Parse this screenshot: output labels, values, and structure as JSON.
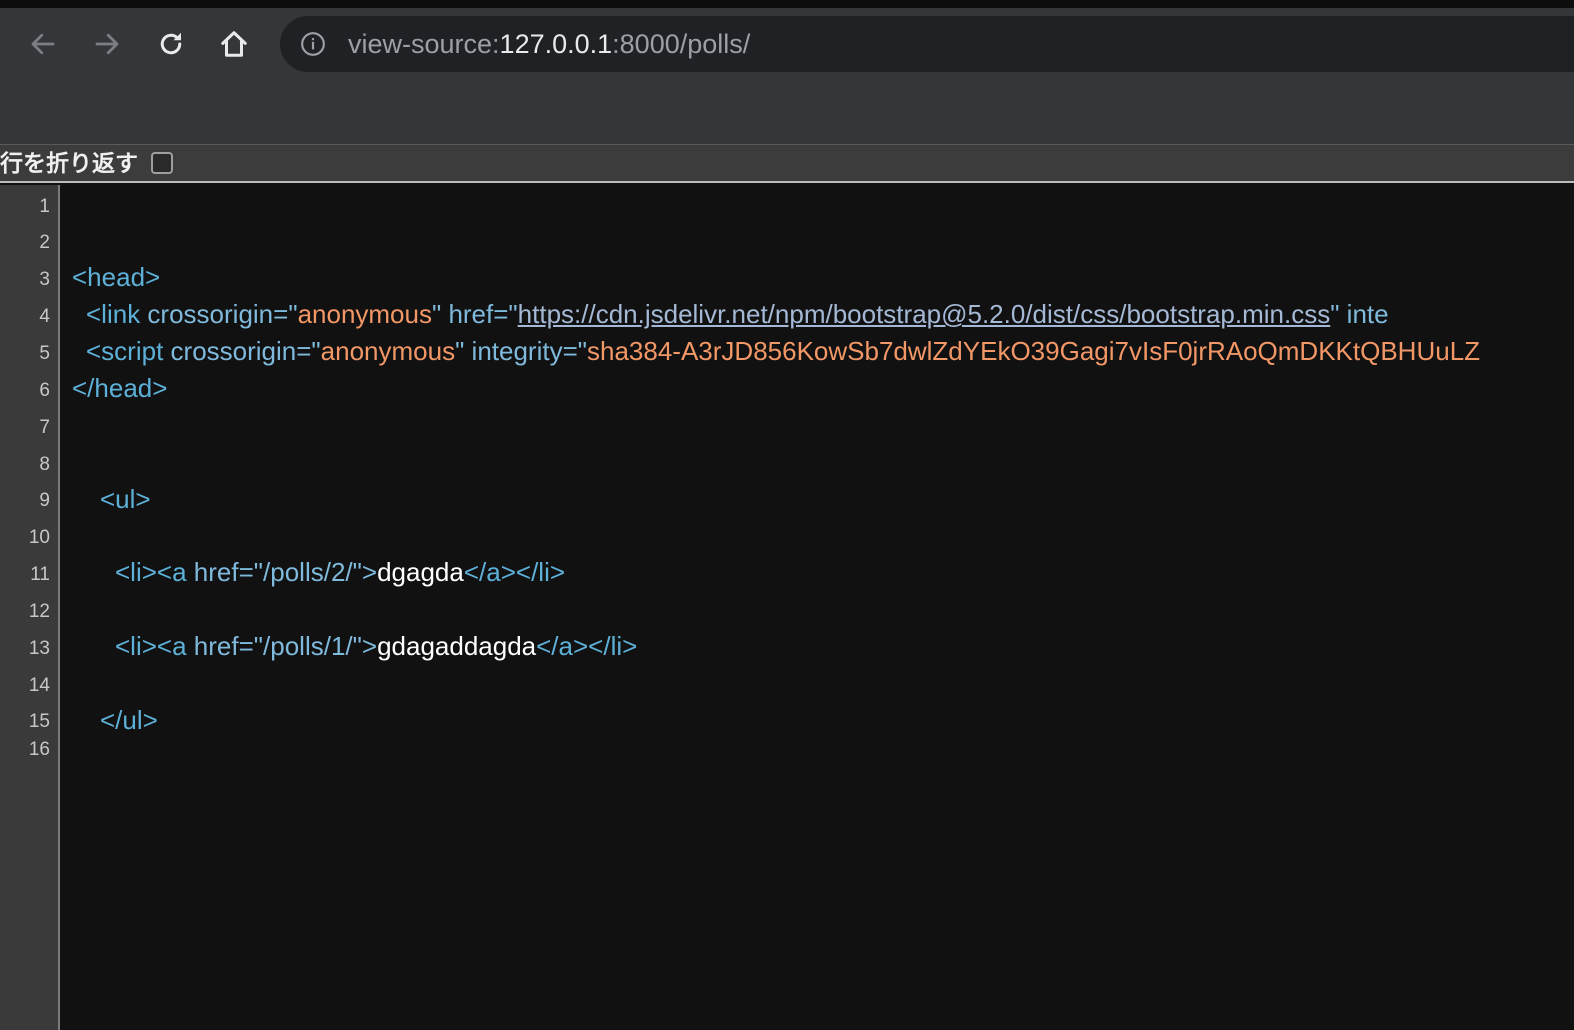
{
  "toolbar": {
    "url_prefix": "view-source:",
    "url_host": "127.0.0.1",
    "url_rest": ":8000/polls/"
  },
  "wrap": {
    "label": "行を折り返す"
  },
  "gutter": {
    "numbers": [
      "1",
      "2",
      "3",
      "4",
      "5",
      "6",
      "7",
      "8",
      "9",
      "10",
      "11",
      "12",
      "13",
      "14",
      "15",
      "16"
    ]
  },
  "code": {
    "l3": {
      "tag": "<head>"
    },
    "l4": {
      "open": "<link",
      "a1": " crossorigin=\"",
      "v1": "anonymous",
      "a2": "\" href=\"",
      "v2": "https://cdn.jsdelivr.net/npm/bootstrap@5.2.0/dist/css/bootstrap.min.css",
      "a3": "\" inte"
    },
    "l5": {
      "open": "<script",
      "a1": " crossorigin=\"",
      "v1": "anonymous",
      "a2": "\" integrity=\"",
      "v2": "sha384-A3rJD856KowSb7dwlZdYEkO39Gagi7vIsF0jrRAoQmDKKtQBHUuLZ"
    },
    "l6": {
      "tag": "</head>"
    },
    "l9": {
      "tag": "<ul>"
    },
    "l11": {
      "open": "<li><a",
      "a1": " href=\"",
      "v1": "/polls/2/",
      "a2": "\">",
      "text": "dgagda",
      "close": "</a></li>"
    },
    "l13": {
      "open": "<li><a",
      "a1": " href=\"",
      "v1": "/polls/1/",
      "a2": "\">",
      "text": "gdagaddagda",
      "close": "</a></li>"
    },
    "l15": {
      "tag": "</ul>"
    }
  },
  "colors": {
    "tag": "#5db0d7",
    "attr_value": "#f29766",
    "link": "#a5b9d6",
    "text": "#ffffff",
    "gutter_bg": "#3a3a3a",
    "code_bg": "#111111"
  }
}
